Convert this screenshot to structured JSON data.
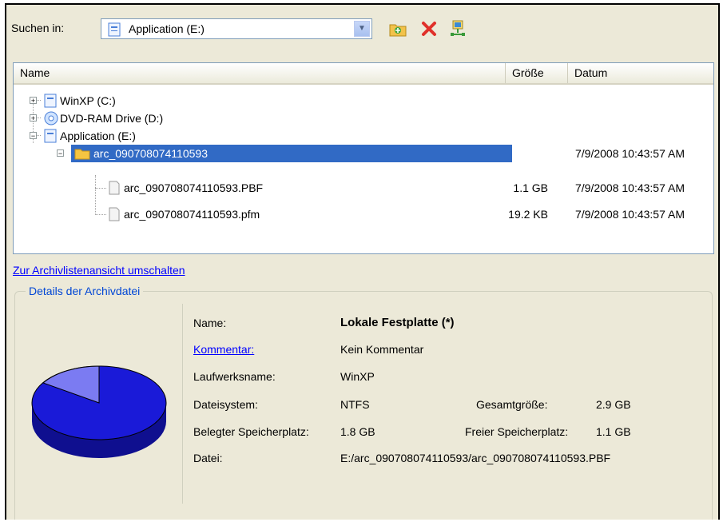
{
  "toolbar": {
    "look_in_label": "Suchen in:",
    "location_value": "Application (E:)",
    "icons": [
      "new-folder-icon",
      "delete-icon",
      "network-icon"
    ]
  },
  "tree": {
    "columns": {
      "name": "Name",
      "size": "Größe",
      "date": "Datum"
    },
    "items": [
      {
        "label": "WinXP (C:)",
        "size": "",
        "date": ""
      },
      {
        "label": "DVD-RAM Drive (D:)",
        "size": "",
        "date": ""
      },
      {
        "label": "Application (E:)",
        "size": "",
        "date": ""
      },
      {
        "label": "arc_090708074110593",
        "size": "",
        "date": "7/9/2008 10:43:57 AM"
      },
      {
        "label": "arc_090708074110593.PBF",
        "size": "1.1 GB",
        "date": "7/9/2008 10:43:57 AM"
      },
      {
        "label": "arc_090708074110593.pfm",
        "size": "19.2 KB",
        "date": "7/9/2008 10:43:57 AM"
      }
    ]
  },
  "toggle_link": "Zur Archivlistenansicht umschalten",
  "details": {
    "legend": "Details der Archivdatei",
    "name_label": "Name:",
    "name_value": "Lokale Festplatte (*)",
    "comment_label": "Kommentar:",
    "comment_value": "Kein Kommentar",
    "drive_label": "Laufwerksname:",
    "drive_value": "WinXP",
    "fs_label": "Dateisystem:",
    "fs_value": "NTFS",
    "total_label": "Gesamtgröße:",
    "total_value": "2.9 GB",
    "used_label": "Belegter Speicherplatz:",
    "used_value": "1.8 GB",
    "free_label": "Freier Speicherplatz:",
    "free_value": "1.1 GB",
    "file_label": "Datei:",
    "file_value": "E:/arc_090708074110593/arc_090708074110593.PBF"
  },
  "colors": {
    "selection": "#316ac5",
    "disk_used": "#1a1ad8",
    "disk_free": "#7b7bf2",
    "link": "#0000ff"
  }
}
